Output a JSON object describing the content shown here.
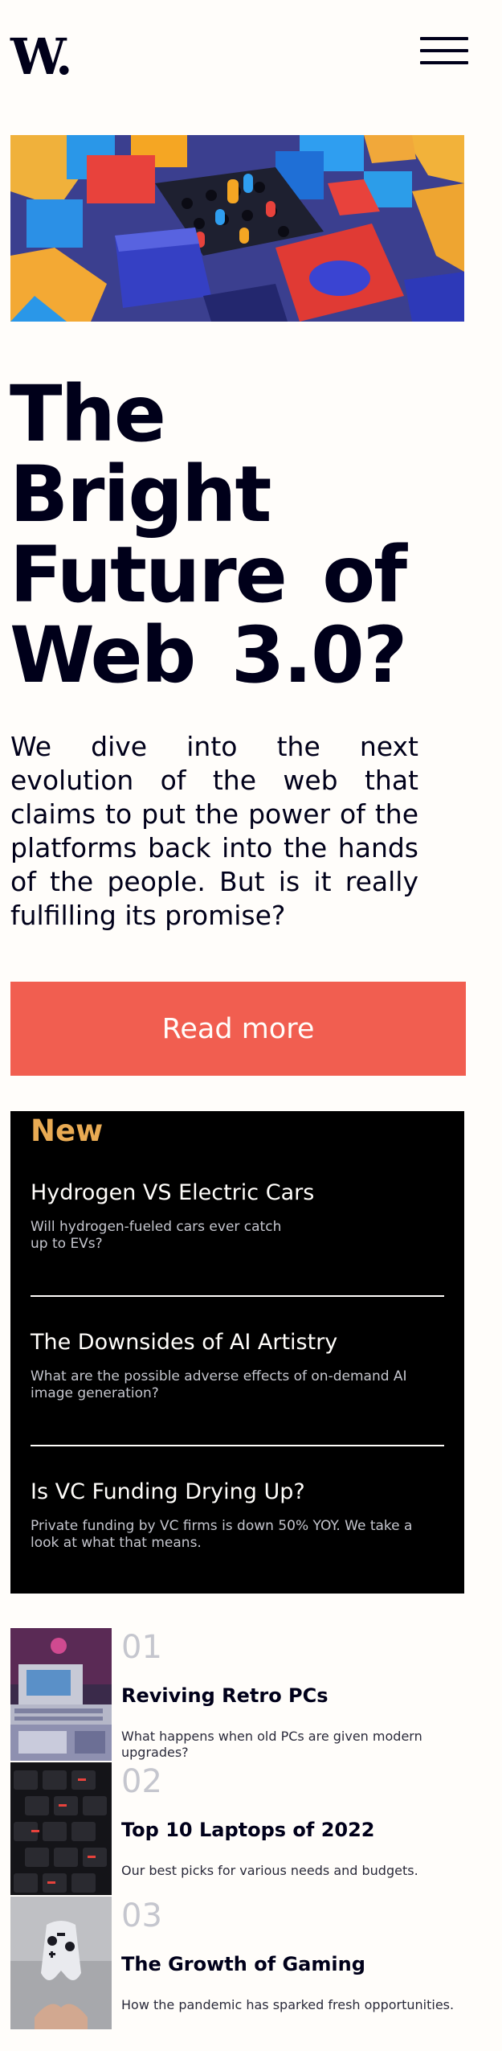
{
  "header": {
    "logo": "W.",
    "menu_icon": "hamburger-menu-icon"
  },
  "hero": {
    "image_icon": "colorful-3d-blocks-illustration",
    "title": "The Bright Future of Web 3.0?",
    "description": "We dive into the next evolution of the web that claims to put the power of the platforms back into the hands of the people. But is it really fulfilling its promise?",
    "button_label": "Read more"
  },
  "new_section": {
    "heading": "New",
    "items": [
      {
        "title": "Hydrogen VS Electric Cars",
        "description": "Will hydrogen-fueled cars ever catch up to EVs?"
      },
      {
        "title": "The Downsides of AI Artistry",
        "description": "What are the possible adverse effects of on-demand AI image generation?"
      },
      {
        "title": "Is VC Funding Drying Up?",
        "description": "Private funding by VC firms is down 50% YOY. We take a look at what that means."
      }
    ]
  },
  "trending": [
    {
      "number": "01",
      "title": "Reviving Retro PCs",
      "description": "What happens when old PCs are given modern upgrades?",
      "image_icon": "retro-pc-photo"
    },
    {
      "number": "02",
      "title": "Top 10 Laptops of 2022",
      "description": "Our best picks for various needs and budgets.",
      "image_icon": "laptop-keyboard-photo"
    },
    {
      "number": "03",
      "title": "The Growth of Gaming",
      "description": "How the pandemic has sparked fresh opportunities.",
      "image_icon": "game-controller-photo"
    }
  ],
  "colors": {
    "accent_red": "#f15e50",
    "accent_orange": "#e9ab53",
    "dark": "#00001a",
    "off_white": "#fffdfa",
    "muted": "#c5c6ce"
  }
}
